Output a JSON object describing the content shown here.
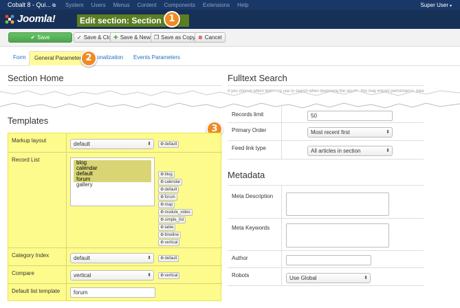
{
  "topnav": {
    "site_name": "Cobalt 8 - Qui...",
    "external_icon": "external-link-icon",
    "menu": [
      "System",
      "Users",
      "Menus",
      "Content",
      "Components",
      "Extensions",
      "Help"
    ],
    "user": "Super User"
  },
  "header": {
    "logo_text": "Joomla!",
    "title": "Edit section: Section 1",
    "badge_1": "1"
  },
  "toolbar": {
    "save": "Save",
    "save_close": "Save & Close",
    "save_new": "Save & New",
    "save_copy": "Save as Copy",
    "cancel": "Cancel"
  },
  "tabs": {
    "form": "Form",
    "general": "General Parameters",
    "personalization": "sonalization",
    "events": "Events Parameters",
    "badge_2": "2"
  },
  "left": {
    "section_home": "Section Home",
    "section_home_text": "",
    "templates_title": "Templates",
    "badge_3": "3",
    "markup_layout": {
      "label": "Markup layout",
      "value": "default",
      "button": "default"
    },
    "record_list": {
      "label": "Record List",
      "options": [
        "blog",
        "calendar",
        "default",
        "forum",
        "gallery"
      ],
      "selected": [
        "blog",
        "calendar",
        "default",
        "forum"
      ],
      "buttons": [
        "blog",
        "calendar",
        "default",
        "forum",
        "map",
        "module_video",
        "simple_list",
        "table",
        "timeline",
        "vertical"
      ]
    },
    "category_index": {
      "label": "Category Index",
      "value": "default",
      "button": "default"
    },
    "compare": {
      "label": "Compare",
      "value": "vertical",
      "button": "vertical"
    },
    "default_list_template": {
      "label": "Default list template",
      "value": "forum"
    }
  },
  "right": {
    "fulltext_title": "Fulltext Search",
    "fulltext_text": "If you choose which field(s) to use to search when displaying the results, this may impact performance, please click the Cobalt",
    "records_limit": {
      "label": "Records limit",
      "value": "50"
    },
    "primary_order": {
      "label": "Primary Order",
      "value": "Most recent first"
    },
    "feed_link_type": {
      "label": "Feed link type",
      "value": "All articles in section"
    },
    "metadata_title": "Metadata",
    "meta_description": {
      "label": "Meta Description",
      "value": ""
    },
    "meta_keywords": {
      "label": "Meta Keywords",
      "value": ""
    },
    "author": {
      "label": "Author",
      "value": ""
    },
    "robots": {
      "label": "Robots",
      "value": "Use Global"
    }
  },
  "colors": {
    "accent": "#1a3867",
    "title_bg": "#5b7e22",
    "highlight": "#fdfb8c",
    "badge": "#f08a24"
  }
}
